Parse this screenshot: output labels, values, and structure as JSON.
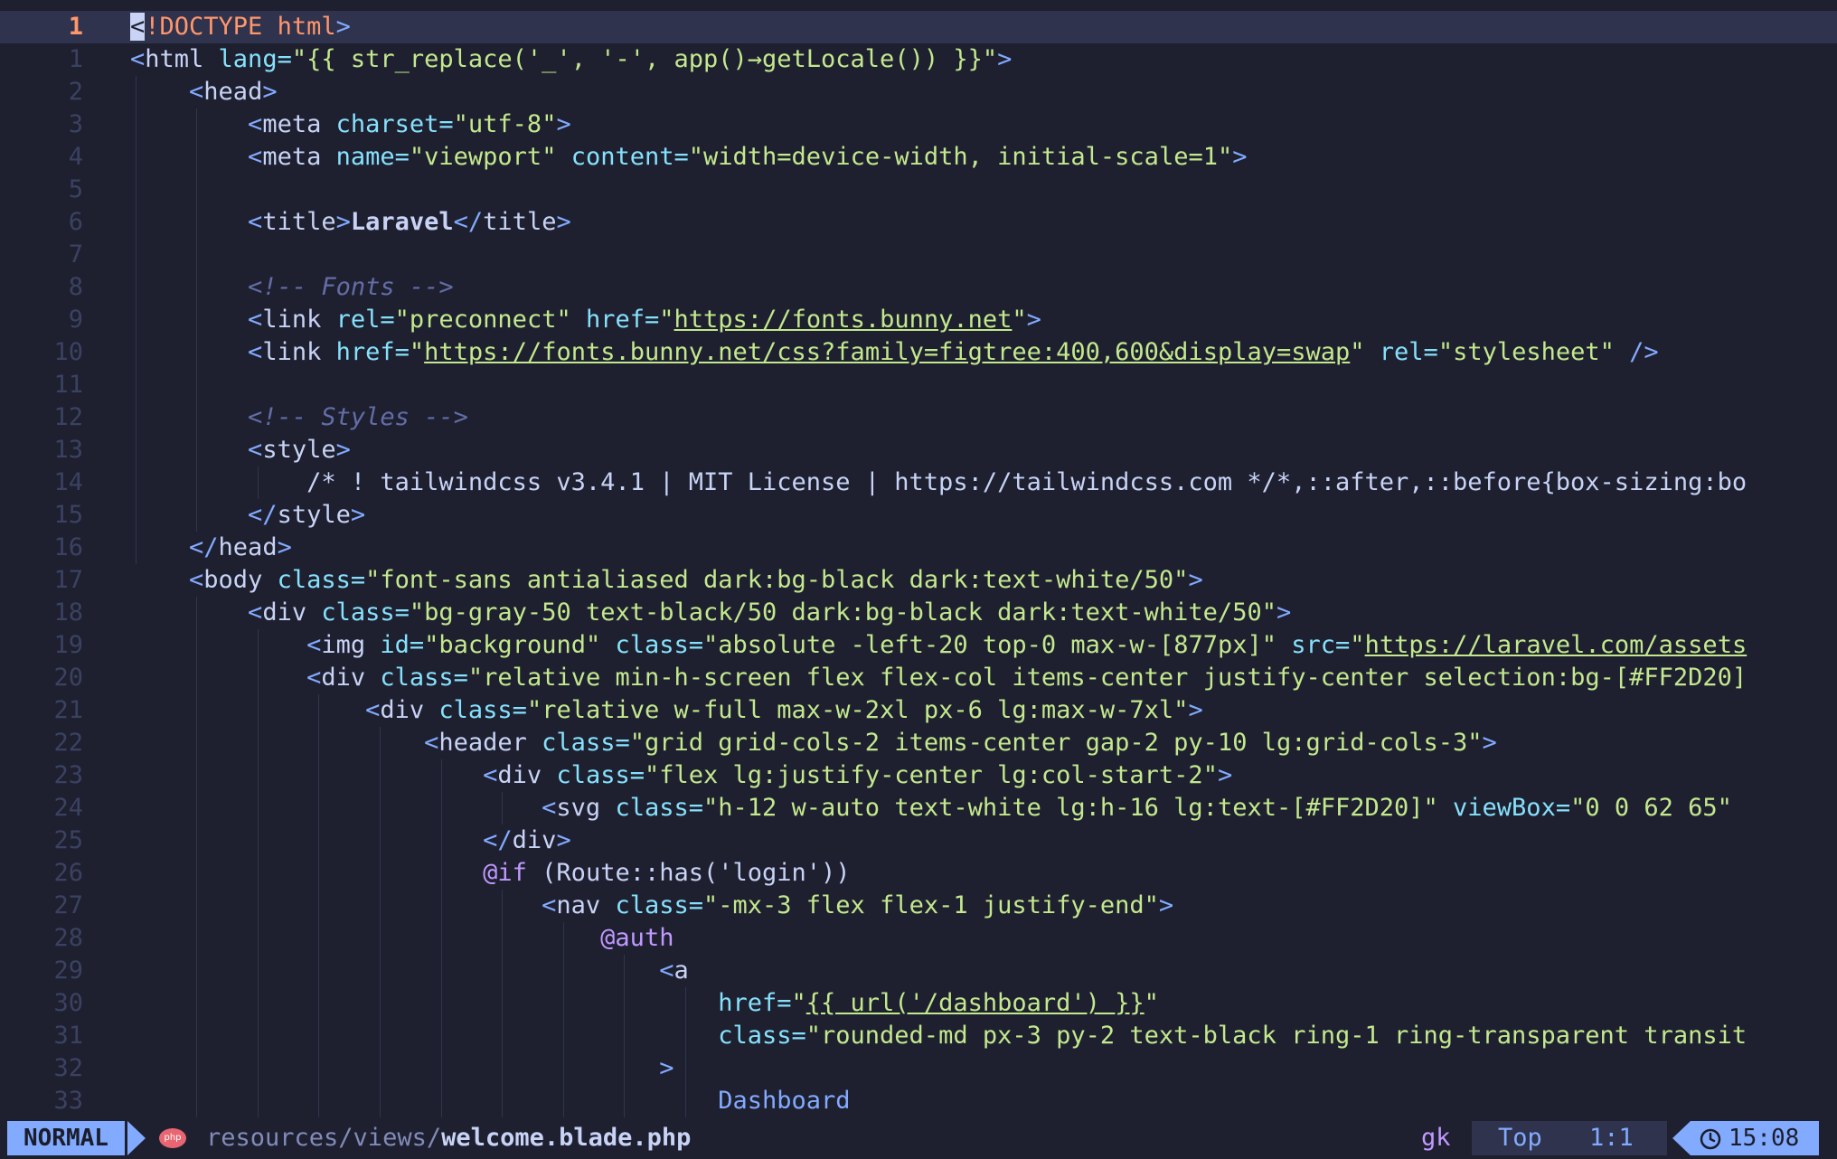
{
  "editor": {
    "lines": [
      {
        "num": "1"
      },
      {
        "num": "1"
      },
      {
        "num": "2"
      },
      {
        "num": "3"
      },
      {
        "num": "4"
      },
      {
        "num": "5"
      },
      {
        "num": "6"
      },
      {
        "num": "7"
      },
      {
        "num": "8"
      },
      {
        "num": "9"
      },
      {
        "num": "10"
      },
      {
        "num": "11"
      },
      {
        "num": "12"
      },
      {
        "num": "13"
      },
      {
        "num": "14"
      },
      {
        "num": "15"
      },
      {
        "num": "16"
      },
      {
        "num": "17"
      },
      {
        "num": "18"
      },
      {
        "num": "19"
      },
      {
        "num": "20"
      },
      {
        "num": "21"
      },
      {
        "num": "22"
      },
      {
        "num": "23"
      },
      {
        "num": "24"
      },
      {
        "num": "25"
      },
      {
        "num": "26"
      },
      {
        "num": "27"
      },
      {
        "num": "28"
      },
      {
        "num": "29"
      },
      {
        "num": "30"
      },
      {
        "num": "31"
      },
      {
        "num": "32"
      },
      {
        "num": "33"
      }
    ],
    "code": [
      [
        [
          "cursor",
          "<"
        ],
        [
          "kw",
          "!DOCTYPE html"
        ],
        [
          "tg",
          ">"
        ]
      ],
      [
        [
          "tg",
          "<"
        ],
        [
          "tn",
          "html "
        ],
        [
          "at",
          "lang"
        ],
        [
          "pn",
          "="
        ],
        [
          "st",
          "\"{{ str_replace('_', '-', app()→getLocale()) }}\""
        ],
        [
          "tg",
          ">"
        ]
      ],
      [
        [
          "tx",
          "    "
        ],
        [
          "tg",
          "<"
        ],
        [
          "tn",
          "head"
        ],
        [
          "tg",
          ">"
        ]
      ],
      [
        [
          "tx",
          "        "
        ],
        [
          "tg",
          "<"
        ],
        [
          "tn",
          "meta "
        ],
        [
          "at",
          "charset"
        ],
        [
          "pn",
          "="
        ],
        [
          "st",
          "\"utf-8\""
        ],
        [
          "tg",
          ">"
        ]
      ],
      [
        [
          "tx",
          "        "
        ],
        [
          "tg",
          "<"
        ],
        [
          "tn",
          "meta "
        ],
        [
          "at",
          "name"
        ],
        [
          "pn",
          "="
        ],
        [
          "st",
          "\"viewport\" "
        ],
        [
          "at",
          "content"
        ],
        [
          "pn",
          "="
        ],
        [
          "st",
          "\"width=device-width, initial-scale=1\""
        ],
        [
          "tg",
          ">"
        ]
      ],
      [
        [
          "tx",
          ""
        ]
      ],
      [
        [
          "tx",
          "        "
        ],
        [
          "tg",
          "<"
        ],
        [
          "tn",
          "title"
        ],
        [
          "tg",
          ">"
        ],
        [
          "bold",
          "Laravel"
        ],
        [
          "tg",
          "</"
        ],
        [
          "tn",
          "title"
        ],
        [
          "tg",
          ">"
        ]
      ],
      [
        [
          "tx",
          ""
        ]
      ],
      [
        [
          "tx",
          "        "
        ],
        [
          "cm",
          "<!-- Fonts -->"
        ]
      ],
      [
        [
          "tx",
          "        "
        ],
        [
          "tg",
          "<"
        ],
        [
          "tn",
          "link "
        ],
        [
          "at",
          "rel"
        ],
        [
          "pn",
          "="
        ],
        [
          "st",
          "\"preconnect\" "
        ],
        [
          "at",
          "href"
        ],
        [
          "pn",
          "="
        ],
        [
          "st",
          "\""
        ],
        [
          "ln",
          "https://fonts.bunny.net"
        ],
        [
          "st",
          "\""
        ],
        [
          "tg",
          ">"
        ]
      ],
      [
        [
          "tx",
          "        "
        ],
        [
          "tg",
          "<"
        ],
        [
          "tn",
          "link "
        ],
        [
          "at",
          "href"
        ],
        [
          "pn",
          "="
        ],
        [
          "st",
          "\""
        ],
        [
          "ln",
          "https://fonts.bunny.net/css?family=figtree:400,600&display=swap"
        ],
        [
          "st",
          "\" "
        ],
        [
          "at",
          "rel"
        ],
        [
          "pn",
          "="
        ],
        [
          "st",
          "\"stylesheet\" "
        ],
        [
          "tg",
          "/>"
        ]
      ],
      [
        [
          "tx",
          ""
        ]
      ],
      [
        [
          "tx",
          "        "
        ],
        [
          "cm",
          "<!-- Styles -->"
        ]
      ],
      [
        [
          "tx",
          "        "
        ],
        [
          "tg",
          "<"
        ],
        [
          "tn",
          "style"
        ],
        [
          "tg",
          ">"
        ]
      ],
      [
        [
          "tx",
          "            "
        ],
        [
          "css",
          "/* ! tailwindcss v3.4.1 | MIT License | https://tailwindcss.com */*,::after,::before{box-sizing:bo"
        ]
      ],
      [
        [
          "tx",
          "        "
        ],
        [
          "tg",
          "</"
        ],
        [
          "tn",
          "style"
        ],
        [
          "tg",
          ">"
        ]
      ],
      [
        [
          "tx",
          "    "
        ],
        [
          "tg",
          "</"
        ],
        [
          "tn",
          "head"
        ],
        [
          "tg",
          ">"
        ]
      ],
      [
        [
          "tx",
          "    "
        ],
        [
          "tg",
          "<"
        ],
        [
          "tn",
          "body "
        ],
        [
          "at",
          "class"
        ],
        [
          "pn",
          "="
        ],
        [
          "st",
          "\"font-sans antialiased dark:bg-black dark:text-white/50\""
        ],
        [
          "tg",
          ">"
        ]
      ],
      [
        [
          "tx",
          "        "
        ],
        [
          "tg",
          "<"
        ],
        [
          "tn",
          "div "
        ],
        [
          "at",
          "class"
        ],
        [
          "pn",
          "="
        ],
        [
          "st",
          "\"bg-gray-50 text-black/50 dark:bg-black dark:text-white/50\""
        ],
        [
          "tg",
          ">"
        ]
      ],
      [
        [
          "tx",
          "            "
        ],
        [
          "tg",
          "<"
        ],
        [
          "tn",
          "img "
        ],
        [
          "at",
          "id"
        ],
        [
          "pn",
          "="
        ],
        [
          "st",
          "\"background\" "
        ],
        [
          "at",
          "class"
        ],
        [
          "pn",
          "="
        ],
        [
          "st",
          "\"absolute -left-20 top-0 max-w-[877px]\" "
        ],
        [
          "at",
          "src"
        ],
        [
          "pn",
          "="
        ],
        [
          "st",
          "\""
        ],
        [
          "ln",
          "https://laravel.com/assets"
        ]
      ],
      [
        [
          "tx",
          "            "
        ],
        [
          "tg",
          "<"
        ],
        [
          "tn",
          "div "
        ],
        [
          "at",
          "class"
        ],
        [
          "pn",
          "="
        ],
        [
          "st",
          "\"relative min-h-screen flex flex-col items-center justify-center selection:bg-[#FF2D20]"
        ]
      ],
      [
        [
          "tx",
          "                "
        ],
        [
          "tg",
          "<"
        ],
        [
          "tn",
          "div "
        ],
        [
          "at",
          "class"
        ],
        [
          "pn",
          "="
        ],
        [
          "st",
          "\"relative w-full max-w-2xl px-6 lg:max-w-7xl\""
        ],
        [
          "tg",
          ">"
        ]
      ],
      [
        [
          "tx",
          "                    "
        ],
        [
          "tg",
          "<"
        ],
        [
          "tn",
          "header "
        ],
        [
          "at",
          "class"
        ],
        [
          "pn",
          "="
        ],
        [
          "st",
          "\"grid grid-cols-2 items-center gap-2 py-10 lg:grid-cols-3\""
        ],
        [
          "tg",
          ">"
        ]
      ],
      [
        [
          "tx",
          "                        "
        ],
        [
          "tg",
          "<"
        ],
        [
          "tn",
          "div "
        ],
        [
          "at",
          "class"
        ],
        [
          "pn",
          "="
        ],
        [
          "st",
          "\"flex lg:justify-center lg:col-start-2\""
        ],
        [
          "tg",
          ">"
        ]
      ],
      [
        [
          "tx",
          "                            "
        ],
        [
          "tg",
          "<"
        ],
        [
          "tn",
          "svg "
        ],
        [
          "at",
          "class"
        ],
        [
          "pn",
          "="
        ],
        [
          "st",
          "\"h-12 w-auto text-white lg:h-16 lg:text-[#FF2D20]\" "
        ],
        [
          "at",
          "viewBox"
        ],
        [
          "pn",
          "="
        ],
        [
          "st",
          "\"0 0 62 65\""
        ]
      ],
      [
        [
          "tx",
          "                        "
        ],
        [
          "tg",
          "</"
        ],
        [
          "tn",
          "div"
        ],
        [
          "tg",
          ">"
        ]
      ],
      [
        [
          "tx",
          "                        "
        ],
        [
          "dr",
          "@if "
        ],
        [
          "tx",
          "(Route::has('login'))"
        ]
      ],
      [
        [
          "tx",
          "                            "
        ],
        [
          "tg",
          "<"
        ],
        [
          "tn",
          "nav "
        ],
        [
          "at",
          "class"
        ],
        [
          "pn",
          "="
        ],
        [
          "st",
          "\"-mx-3 flex flex-1 justify-end\""
        ],
        [
          "tg",
          ">"
        ]
      ],
      [
        [
          "tx",
          "                                "
        ],
        [
          "dr",
          "@auth"
        ]
      ],
      [
        [
          "tx",
          "                                    "
        ],
        [
          "tg",
          "<"
        ],
        [
          "tn",
          "a"
        ]
      ],
      [
        [
          "tx",
          "                                        "
        ],
        [
          "at",
          "href"
        ],
        [
          "pn",
          "="
        ],
        [
          "st",
          "\""
        ],
        [
          "ln",
          "{{ url('/dashboard') }}"
        ],
        [
          "st",
          "\""
        ]
      ],
      [
        [
          "tx",
          "                                        "
        ],
        [
          "at",
          "class"
        ],
        [
          "pn",
          "="
        ],
        [
          "st",
          "\"rounded-md px-3 py-2 text-black ring-1 ring-transparent transit"
        ]
      ],
      [
        [
          "tx",
          "                                    "
        ],
        [
          "tg",
          ">"
        ]
      ],
      [
        [
          "tx",
          "                                        "
        ],
        [
          "tg",
          "Dashboard"
        ]
      ]
    ]
  },
  "statusline": {
    "mode": "NORMAL",
    "filetype_icon": "php-icon",
    "filetype_label": "php",
    "path_dir": "resources/views/",
    "path_file": "welcome.blade.php",
    "keys": "gk",
    "scroll": "Top",
    "cursor": "1:1",
    "clock_icon": "clock-icon",
    "time": "15:08"
  },
  "colors": {
    "background": "#1e2030",
    "current_line": "#2f334d",
    "accent": "#82aaff",
    "string": "#c3e88d",
    "attribute": "#86e1fc",
    "comment": "#636da6",
    "directive": "#c099ff",
    "keyword": "#ff966c"
  }
}
